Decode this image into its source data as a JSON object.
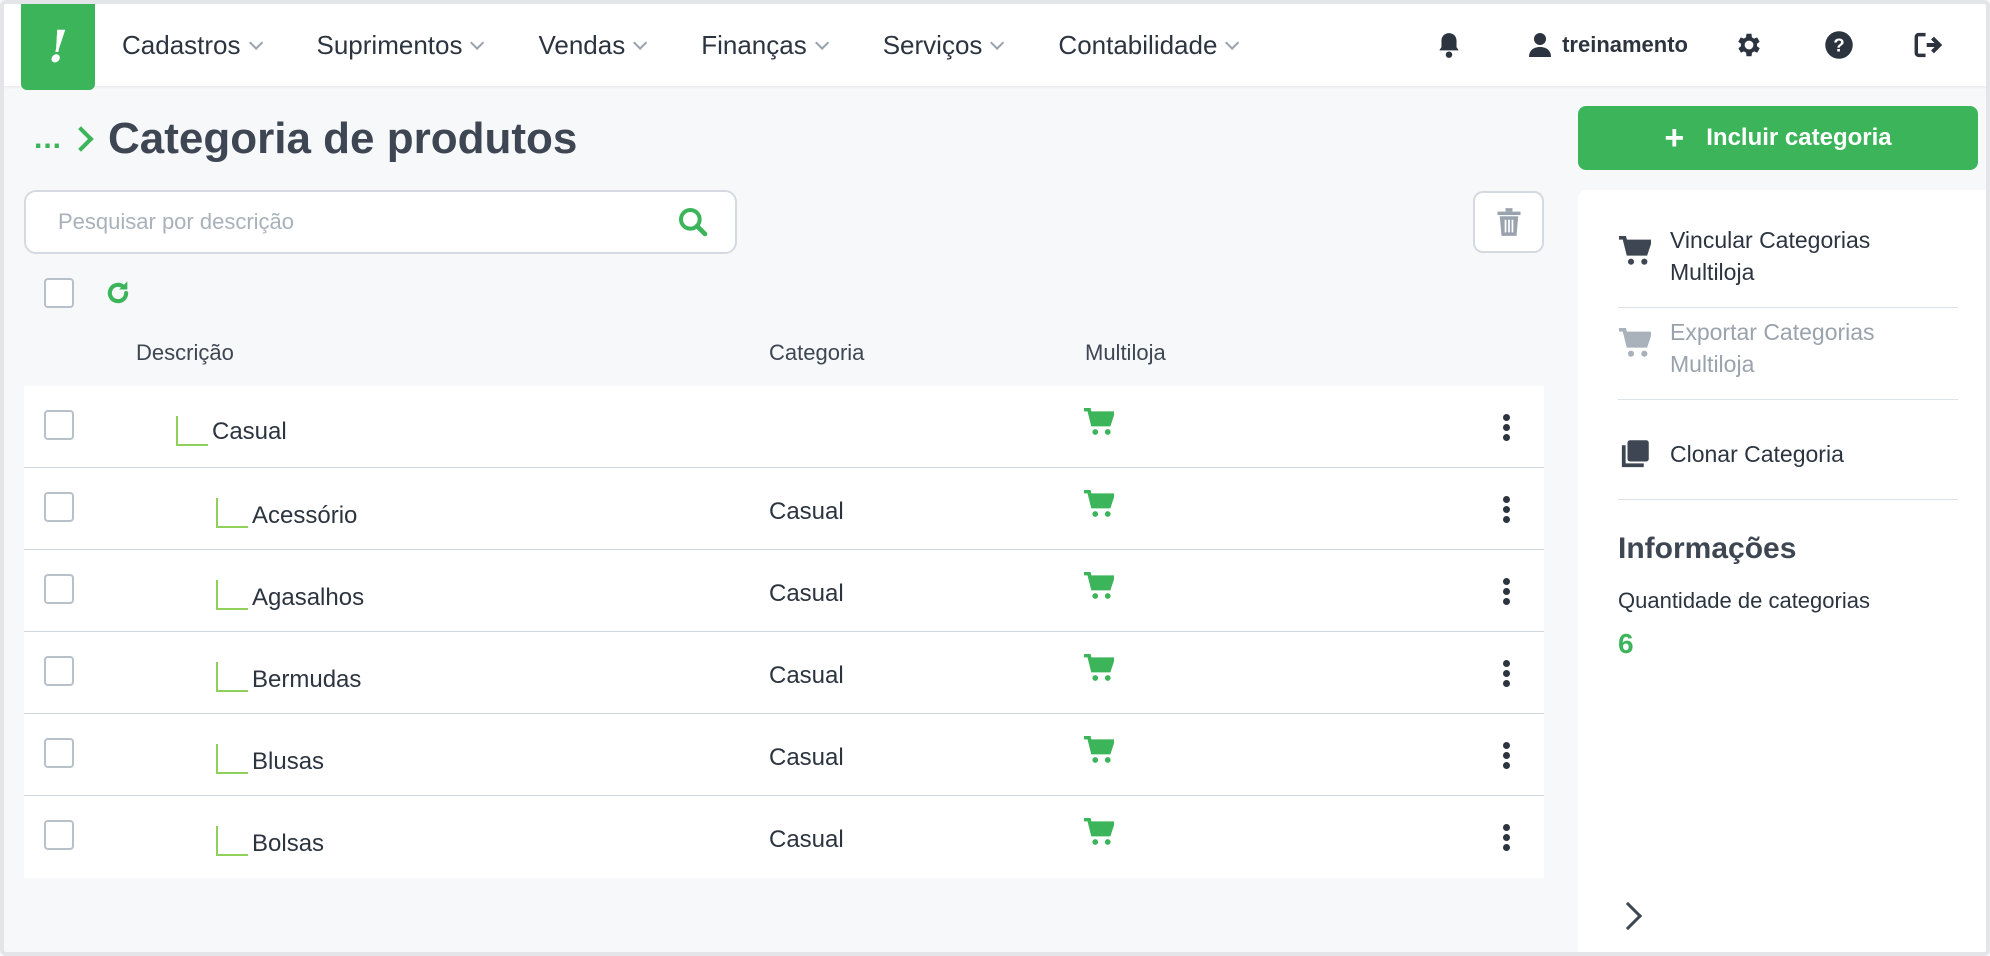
{
  "brand": {
    "logo_text": "!",
    "accent": "#3cb55a"
  },
  "nav": {
    "items": [
      {
        "label": "Cadastros"
      },
      {
        "label": "Suprimentos"
      },
      {
        "label": "Vendas"
      },
      {
        "label": "Finanças"
      },
      {
        "label": "Serviços"
      },
      {
        "label": "Contabilidade"
      }
    ],
    "user": "treinamento",
    "icons": [
      "bell-icon",
      "user-icon",
      "gear-icon",
      "help-icon",
      "logout-icon"
    ]
  },
  "breadcrumb": {
    "dots": "...",
    "title": "Categoria de produtos"
  },
  "search": {
    "placeholder": "Pesquisar por descrição",
    "value": ""
  },
  "table": {
    "headers": {
      "description": "Descrição",
      "category": "Categoria",
      "multistore": "Multiloja"
    },
    "rows": [
      {
        "description": "Casual",
        "category": "",
        "level": 1
      },
      {
        "description": "Acessório",
        "category": "Casual",
        "level": 2
      },
      {
        "description": "Agasalhos",
        "category": "Casual",
        "level": 2
      },
      {
        "description": "Bermudas",
        "category": "Casual",
        "level": 2
      },
      {
        "description": "Blusas",
        "category": "Casual",
        "level": 2
      },
      {
        "description": "Bolsas",
        "category": "Casual",
        "level": 2
      }
    ]
  },
  "side": {
    "add_button": "Incluir categoria",
    "actions": {
      "link_multistore": "Vincular Categorias Multiloja",
      "export_multistore": "Exportar Categorias Multiloja",
      "clone": "Clonar Categoria"
    },
    "info": {
      "title": "Informações",
      "count_label": "Quantidade de categorias",
      "count_value": "6"
    }
  }
}
